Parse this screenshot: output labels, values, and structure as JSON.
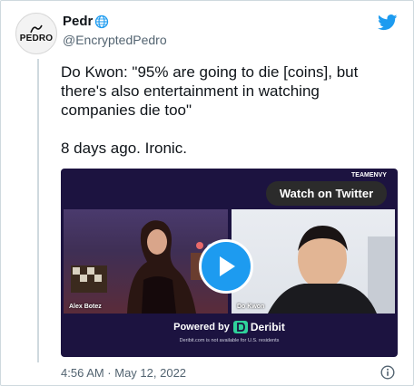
{
  "author": {
    "display_name": "Pedr",
    "handle": "@EncryptedPedro",
    "avatar_text": "PEDRO"
  },
  "tweet": {
    "text_line1": "Do Kwon: \"95% are going to die [coins], but there's also entertainment in watching companies die too\"",
    "text_line2": "8 days ago. Ironic."
  },
  "media": {
    "watch_label": "Watch on Twitter",
    "watermark": "TEAMENVY",
    "left_name": "Alex Botez",
    "right_name": "Do Kwon",
    "powered_by": "Powered by",
    "sponsor": "Deribit",
    "disclaimer": "Deribit.com is not available for U.S. residents"
  },
  "meta": {
    "timestamp": "4:56 AM · May 12, 2022"
  },
  "icons": [
    "globe-icon",
    "twitter-bird-icon",
    "play-icon",
    "info-icon",
    "deribit-logo-icon"
  ],
  "colors": {
    "twitter_blue": "#1d9bf0",
    "media_bg": "#1c1340",
    "secondary_text": "#536471",
    "sponsor_green": "#2fd39b"
  }
}
